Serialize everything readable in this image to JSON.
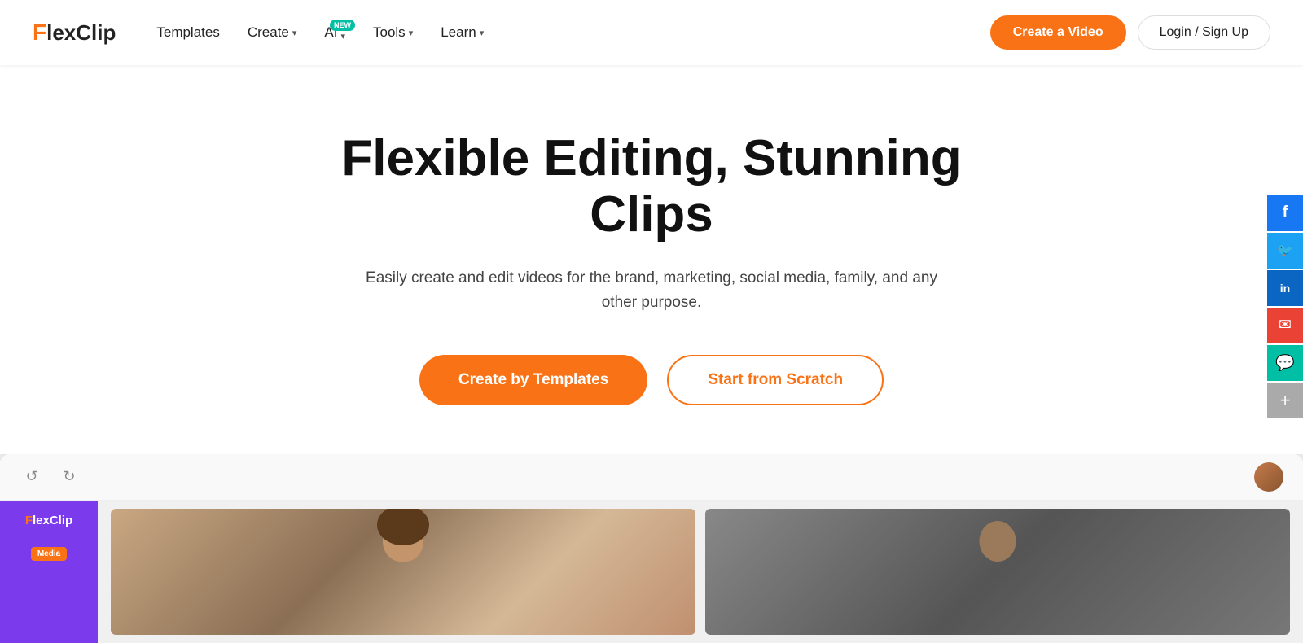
{
  "brand": {
    "name": "FlexClip",
    "logo_f": "F",
    "logo_rest": "lexClip"
  },
  "nav": {
    "templates_label": "Templates",
    "create_label": "Create",
    "ai_label": "AI",
    "ai_badge": "NEW",
    "tools_label": "Tools",
    "learn_label": "Learn",
    "create_video_btn": "Create a Video",
    "login_btn": "Login / Sign Up"
  },
  "hero": {
    "title": "Flexible Editing, Stunning Clips",
    "subtitle": "Easily create and edit videos for the brand, marketing, social media, family, and any other purpose.",
    "btn_templates": "Create by Templates",
    "btn_scratch": "Start from Scratch"
  },
  "editor": {
    "undo_icon": "↺",
    "redo_icon": "↻",
    "logo_f": "F",
    "logo_rest": "lexClip",
    "media_label": "Media",
    "user_avatar_alt": "user avatar"
  },
  "social": {
    "facebook": "f",
    "twitter": "🐦",
    "linkedin": "in",
    "email": "✉",
    "chat": "💬",
    "more": "+"
  }
}
